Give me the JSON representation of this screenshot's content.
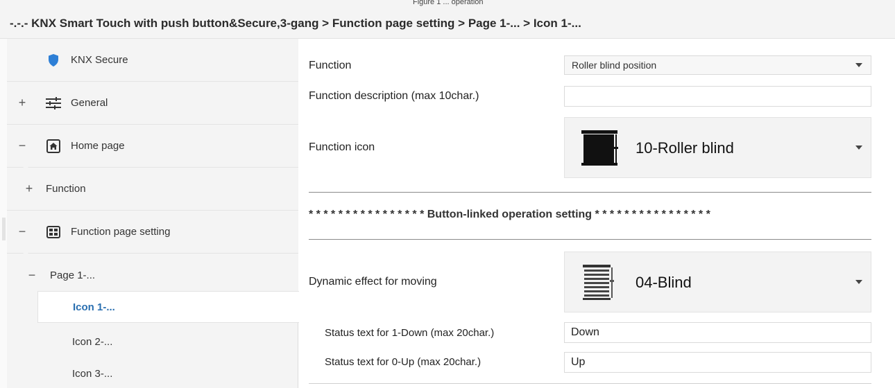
{
  "window": {
    "top_caption": "Figure 1 ... operation",
    "breadcrumb": "-.-.- KNX Smart Touch with push button&Secure,3-gang > Function page setting > Page 1-... > Icon 1-..."
  },
  "sidebar": {
    "items": [
      {
        "label": "KNX Secure",
        "toggle": "",
        "icon": "shield-icon"
      },
      {
        "label": "General",
        "toggle": "+",
        "icon": "sliders-icon"
      },
      {
        "label": "Home page",
        "toggle": "−",
        "icon": "home-icon"
      },
      {
        "label": "Function",
        "toggle": "+",
        "icon": ""
      },
      {
        "label": "Function page setting",
        "toggle": "−",
        "icon": "grid-icon"
      },
      {
        "label": "Page 1-...",
        "toggle": "−",
        "icon": ""
      }
    ],
    "sub_items": [
      "Icon 1-...",
      "Icon 2-...",
      "Icon 3-..."
    ],
    "active_sub_item": "Icon 1-..."
  },
  "main": {
    "function_label": "Function",
    "function_value": "Roller blind position",
    "description_label": "Function description (max 10char.)",
    "description_value": "",
    "icon_label": "Function icon",
    "icon_value": "10-Roller blind",
    "section_title": "* * * * * * * * * * * * * * * * Button-linked operation setting * * * * * * * * * * * * * * * *",
    "dynamic_label": "Dynamic effect for moving",
    "dynamic_value": "04-Blind",
    "down_label": "Status text for 1-Down (max 20char.)",
    "down_value": "Down",
    "up_label": "Status text for 0-Up (max 20char.)",
    "up_value": "Up"
  },
  "colors": {
    "accent_active": "#2a6fb0",
    "shield": "#2d7fd6",
    "panel_bg": "#f4f4f4"
  }
}
